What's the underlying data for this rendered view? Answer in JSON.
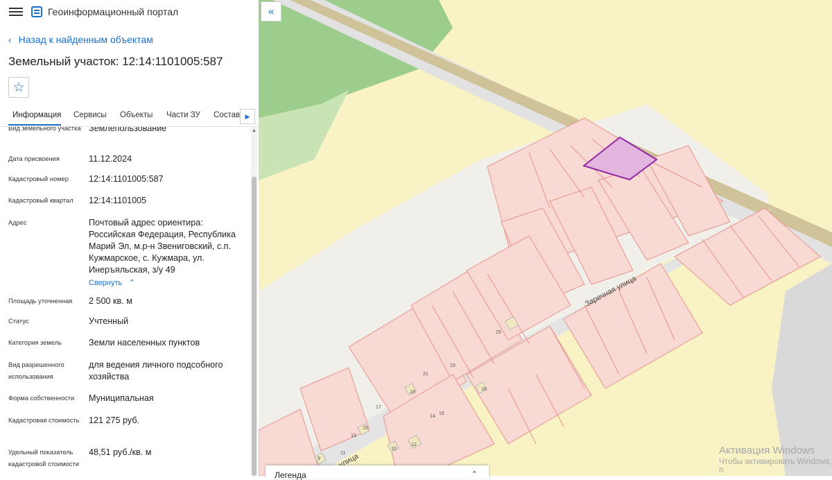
{
  "app": {
    "title": "Геоинформационный портал"
  },
  "back_link": "Назад к найденным объектам",
  "page_title": "Земельный участок: 12:14:1101005:587",
  "tabs": [
    "Информация",
    "Сервисы",
    "Объекты",
    "Части ЗУ",
    "Состав"
  ],
  "fields": [
    {
      "label": "Вид земельного участка",
      "value": "Землепользование"
    },
    {
      "label": "Дата присвоения",
      "value": "11.12.2024"
    },
    {
      "label": "Кадастровый номер",
      "value": "12:14:1101005:587"
    },
    {
      "label": "Кадастровый квартал",
      "value": "12:14:1101005"
    },
    {
      "label": "Адрес",
      "value": "Почтовый адрес ориентира: Российская Федерация, Республика Марий Эл, м.р-н Звениговский, с.п. Кужмарское, с. Кужмара, ул. Инеръяльская, з/у 49",
      "action": "Свернуть"
    },
    {
      "label": "Площадь уточненная",
      "value": "2 500 кв. м"
    },
    {
      "label": "Статус",
      "value": "Учтенный"
    },
    {
      "label": "Категория земель",
      "value": "Земли населенных пунктов"
    },
    {
      "label": "Вид разрешенного использования",
      "value": "для ведения личного подсобного хозяйства"
    },
    {
      "label": "Форма собственности",
      "value": "Муниципальная"
    },
    {
      "label": "Кадастровая стоимость",
      "value": "121 275 руб."
    },
    {
      "label": "Удельный показатель кадастровой стоимости",
      "value": "48,51 руб./кв. м"
    }
  ],
  "map": {
    "street_labels": [
      "Заречная улица",
      "улица"
    ],
    "parcel_numbers": [
      "29",
      "23",
      "21",
      "19",
      "18",
      "17",
      "16",
      "15",
      "14",
      "13",
      "12",
      "11",
      "10",
      "9"
    ],
    "colors": {
      "fields": "#f8f2c4",
      "forest": "#9ccd8c",
      "road": "#d8d8d8",
      "parcel_fill": "#f8d9d4",
      "parcel_stroke": "#e9938a",
      "selected_fill": "#e4b6df",
      "selected_stroke": "#8e27a0"
    }
  },
  "legend": {
    "title": "Легенда"
  },
  "watermark": {
    "line1": "Активация Windows",
    "line2": "Чтобы активировать Windows, п"
  }
}
